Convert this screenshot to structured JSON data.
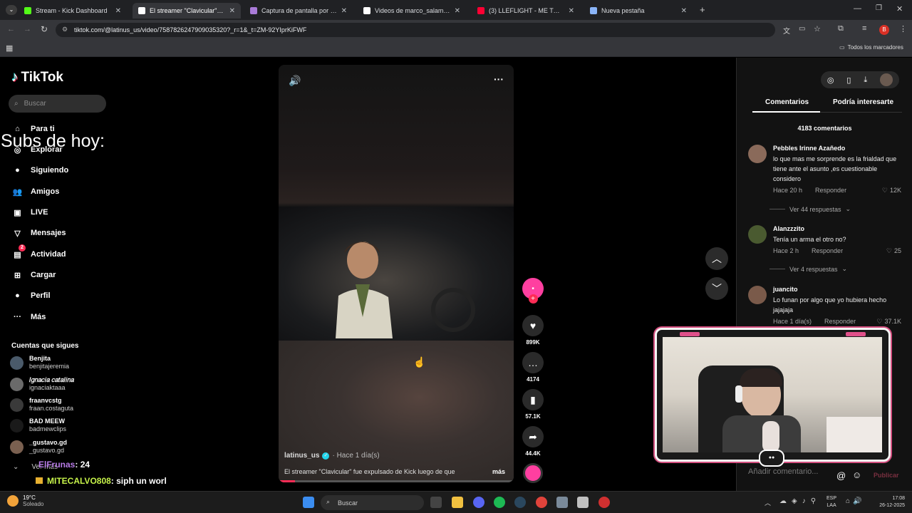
{
  "browser": {
    "tabs": [
      {
        "label": "Stream - Kick Dashboard",
        "color": "#53fc18"
      },
      {
        "label": "El streamer \"Clavicular\" fue",
        "color": "#ffffff",
        "active": true
      },
      {
        "label": "Captura de pantalla por Lightsh",
        "color": "#a97bd8"
      },
      {
        "label": "Videos de marco_salamanca (@",
        "color": "#ffffff"
      },
      {
        "label": "(3) LLEFLIGHT - ME TOCA A MÍ",
        "color": "#ff0033"
      },
      {
        "label": "Nueva pestaña",
        "color": "#8ab4f8"
      }
    ],
    "url": "tiktok.com/@latinus_us/video/7587826247909035320?_r=1&_t=ZM-92YIprKiFWF",
    "bookmarks_label": "Todos los marcadores"
  },
  "tiktok": {
    "logo": "TikTok",
    "search_placeholder": "Buscar",
    "nav": [
      {
        "label": "Para ti",
        "icon": "home-icon",
        "glyph": "⌂"
      },
      {
        "label": "Explorar",
        "icon": "compass-icon",
        "glyph": "◎"
      },
      {
        "label": "Siguiendo",
        "icon": "following-icon",
        "glyph": "●"
      },
      {
        "label": "Amigos",
        "icon": "friends-icon",
        "glyph": "👥"
      },
      {
        "label": "LIVE",
        "icon": "live-icon",
        "glyph": "▣"
      },
      {
        "label": "Mensajes",
        "icon": "messages-icon",
        "glyph": "▽"
      },
      {
        "label": "Actividad",
        "icon": "activity-icon",
        "glyph": "▤",
        "badge": "2"
      },
      {
        "label": "Cargar",
        "icon": "upload-icon",
        "glyph": "⊞"
      },
      {
        "label": "Perfil",
        "icon": "profile-icon",
        "glyph": "●"
      },
      {
        "label": "Más",
        "icon": "more-icon",
        "glyph": "···"
      }
    ],
    "following_title": "Cuentas que sigues",
    "accounts": [
      {
        "name": "Benjita",
        "handle": "benjitajeremia"
      },
      {
        "name": "𝐼𝑔𝑛𝑎𝑐𝑖𝑎 𝑐𝑎𝑡𝑎𝑙𝑖𝑛𝑎",
        "handle": "ignaciaktaaa"
      },
      {
        "name": "fraanvcstg",
        "handle": "fraan.costaguta"
      },
      {
        "name": "BAD MEEW",
        "handle": "badmewclips"
      },
      {
        "name": "_gustavo.gd",
        "handle": "_gustavo.gd"
      }
    ],
    "see_more": "Ver más"
  },
  "overlay": {
    "subs_title": "Subs de hoy:",
    "chat": [
      {
        "user": "ElFrunas",
        "text": ": 24",
        "color": "#b77be6"
      },
      {
        "user": "MITECALVO808",
        "text": ": siph un worl",
        "color": "#c6f24a"
      }
    ]
  },
  "video": {
    "author": "latinus_us",
    "time": "· Hace 1 día(s)",
    "description": "El streamer \"Clavicular\" fue expulsado de Kick luego de que",
    "more": "más",
    "progress": 0.07,
    "actions": [
      {
        "icon": "heart-icon",
        "glyph": "♥",
        "count": "899K"
      },
      {
        "icon": "comment-icon",
        "glyph": "…",
        "count": "4174"
      },
      {
        "icon": "bookmark-icon",
        "glyph": "▮",
        "count": "57.1K"
      },
      {
        "icon": "share-icon",
        "glyph": "➦",
        "count": "44.4K"
      }
    ]
  },
  "comments_panel": {
    "tab_comments": "Comentarios",
    "tab_interesting": "Podría interesarte",
    "count": "4183 comentarios",
    "comments": [
      {
        "user": "Pebbles Irinne Azañedo",
        "text": "lo que mas me sorprende es la frialdad que tiene ante el asunto ,es cuestionable considero",
        "time": "Hace 20 h",
        "reply": "Responder",
        "likes": "12K",
        "replies": "Ver 44 respuestas"
      },
      {
        "user": "Alanzzzito",
        "text": "Tenía un arma el otro no?",
        "time": "Hace 2 h",
        "reply": "Responder",
        "likes": "25",
        "replies": "Ver 4 respuestas"
      },
      {
        "user": "juancito",
        "text": "Lo funan por algo que yo hubiera hecho jajajaja",
        "time": "Hace 1 día(s)",
        "reply": "Responder",
        "likes": "37.1K",
        "replies": ""
      }
    ],
    "input_placeholder": "Añadir comentario...",
    "publish": "Publicar"
  },
  "taskbar": {
    "weather_temp": "19°C",
    "weather_desc": "Soleado",
    "search_placeholder": "Buscar",
    "lang1": "ESP",
    "lang2": "LAA",
    "time": "17:08",
    "date": "26-12-2025"
  }
}
